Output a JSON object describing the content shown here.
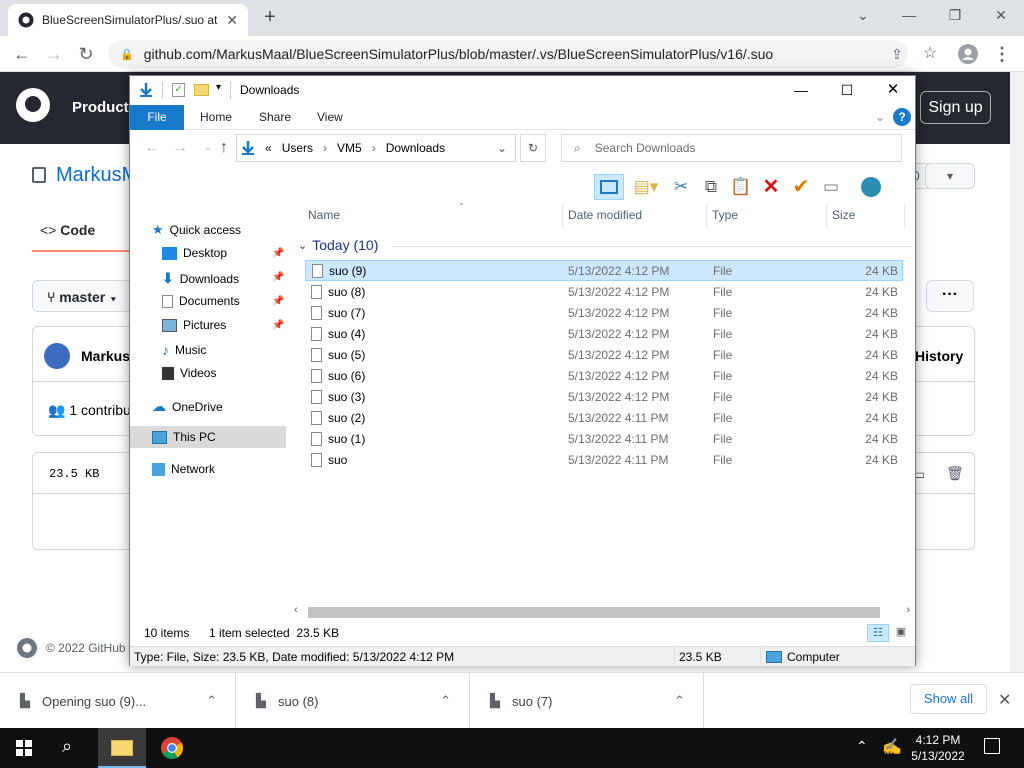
{
  "browser": {
    "tab_title": "BlueScreenSimulatorPlus/.suo at",
    "new_tab_icon": "plus-icon",
    "url": "github.com/MarkusMaal/BlueScreenSimulatorPlus/blob/master/.vs/BlueScreenSimulatorPlus/v16/.suo"
  },
  "github": {
    "product": "Product",
    "sign_up": "Sign up",
    "repo_owner": "MarkusM",
    "code_tab": "Code",
    "branch": "master",
    "more": "···",
    "commit_author": "Markus",
    "history": "History",
    "contributors": "1 contribu",
    "file_size": "23.5 KB",
    "star_count": "0",
    "copyright": "© 2022 GitHub"
  },
  "explorer": {
    "title": "Downloads",
    "ribbon_tabs": [
      "File",
      "Home",
      "Share",
      "View"
    ],
    "breadcrumb": [
      "«",
      "Users",
      "VM5",
      "Downloads"
    ],
    "search_placeholder": "Search Downloads",
    "nav": {
      "quick_access": "Quick access",
      "desktop": "Desktop",
      "downloads": "Downloads",
      "documents": "Documents",
      "pictures": "Pictures",
      "music": "Music",
      "videos": "Videos",
      "onedrive": "OneDrive",
      "this_pc": "This PC",
      "network": "Network"
    },
    "columns": {
      "name": "Name",
      "date": "Date modified",
      "type": "Type",
      "size": "Size"
    },
    "group": "Today (10)",
    "files": [
      {
        "name": "suo (9)",
        "date": "5/13/2022 4:12 PM",
        "type": "File",
        "size": "24 KB"
      },
      {
        "name": "suo (8)",
        "date": "5/13/2022 4:12 PM",
        "type": "File",
        "size": "24 KB"
      },
      {
        "name": "suo (7)",
        "date": "5/13/2022 4:12 PM",
        "type": "File",
        "size": "24 KB"
      },
      {
        "name": "suo (4)",
        "date": "5/13/2022 4:12 PM",
        "type": "File",
        "size": "24 KB"
      },
      {
        "name": "suo (5)",
        "date": "5/13/2022 4:12 PM",
        "type": "File",
        "size": "24 KB"
      },
      {
        "name": "suo (6)",
        "date": "5/13/2022 4:12 PM",
        "type": "File",
        "size": "24 KB"
      },
      {
        "name": "suo (3)",
        "date": "5/13/2022 4:12 PM",
        "type": "File",
        "size": "24 KB"
      },
      {
        "name": "suo (2)",
        "date": "5/13/2022 4:11 PM",
        "type": "File",
        "size": "24 KB"
      },
      {
        "name": "suo (1)",
        "date": "5/13/2022 4:11 PM",
        "type": "File",
        "size": "24 KB"
      },
      {
        "name": "suo",
        "date": "5/13/2022 4:11 PM",
        "type": "File",
        "size": "24 KB"
      }
    ],
    "status_items": "10 items",
    "status_selected": "1 item selected  23.5 KB",
    "details": "Type: File, Size: 23.5 KB, Date modified: 5/13/2022 4:12 PM",
    "details_size": "23.5 KB",
    "details_location": "Computer"
  },
  "downloads": {
    "items": [
      "Opening suo (9)...",
      "suo (8)",
      "suo (7)"
    ],
    "show_all": "Show all"
  },
  "taskbar": {
    "time": "4:12 PM",
    "date": "5/13/2022"
  }
}
